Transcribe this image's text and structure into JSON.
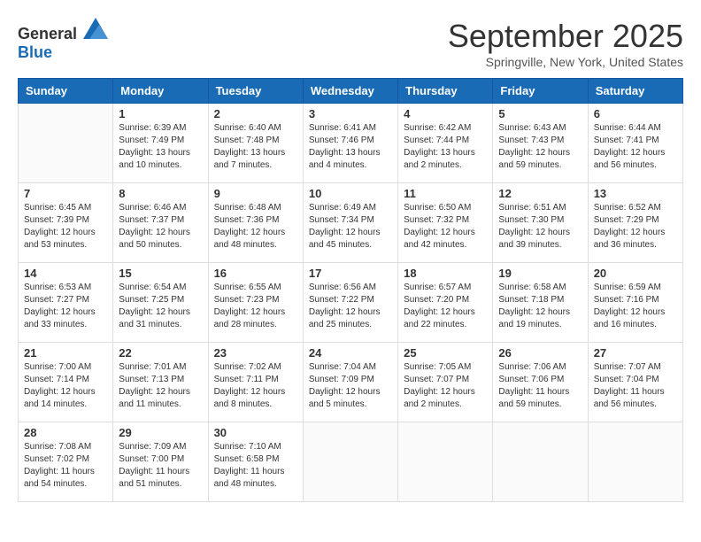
{
  "header": {
    "logo_general": "General",
    "logo_blue": "Blue",
    "month_title": "September 2025",
    "location": "Springville, New York, United States"
  },
  "weekdays": [
    "Sunday",
    "Monday",
    "Tuesday",
    "Wednesday",
    "Thursday",
    "Friday",
    "Saturday"
  ],
  "weeks": [
    [
      {
        "day": "",
        "info": ""
      },
      {
        "day": "1",
        "info": "Sunrise: 6:39 AM\nSunset: 7:49 PM\nDaylight: 13 hours\nand 10 minutes."
      },
      {
        "day": "2",
        "info": "Sunrise: 6:40 AM\nSunset: 7:48 PM\nDaylight: 13 hours\nand 7 minutes."
      },
      {
        "day": "3",
        "info": "Sunrise: 6:41 AM\nSunset: 7:46 PM\nDaylight: 13 hours\nand 4 minutes."
      },
      {
        "day": "4",
        "info": "Sunrise: 6:42 AM\nSunset: 7:44 PM\nDaylight: 13 hours\nand 2 minutes."
      },
      {
        "day": "5",
        "info": "Sunrise: 6:43 AM\nSunset: 7:43 PM\nDaylight: 12 hours\nand 59 minutes."
      },
      {
        "day": "6",
        "info": "Sunrise: 6:44 AM\nSunset: 7:41 PM\nDaylight: 12 hours\nand 56 minutes."
      }
    ],
    [
      {
        "day": "7",
        "info": "Sunrise: 6:45 AM\nSunset: 7:39 PM\nDaylight: 12 hours\nand 53 minutes."
      },
      {
        "day": "8",
        "info": "Sunrise: 6:46 AM\nSunset: 7:37 PM\nDaylight: 12 hours\nand 50 minutes."
      },
      {
        "day": "9",
        "info": "Sunrise: 6:48 AM\nSunset: 7:36 PM\nDaylight: 12 hours\nand 48 minutes."
      },
      {
        "day": "10",
        "info": "Sunrise: 6:49 AM\nSunset: 7:34 PM\nDaylight: 12 hours\nand 45 minutes."
      },
      {
        "day": "11",
        "info": "Sunrise: 6:50 AM\nSunset: 7:32 PM\nDaylight: 12 hours\nand 42 minutes."
      },
      {
        "day": "12",
        "info": "Sunrise: 6:51 AM\nSunset: 7:30 PM\nDaylight: 12 hours\nand 39 minutes."
      },
      {
        "day": "13",
        "info": "Sunrise: 6:52 AM\nSunset: 7:29 PM\nDaylight: 12 hours\nand 36 minutes."
      }
    ],
    [
      {
        "day": "14",
        "info": "Sunrise: 6:53 AM\nSunset: 7:27 PM\nDaylight: 12 hours\nand 33 minutes."
      },
      {
        "day": "15",
        "info": "Sunrise: 6:54 AM\nSunset: 7:25 PM\nDaylight: 12 hours\nand 31 minutes."
      },
      {
        "day": "16",
        "info": "Sunrise: 6:55 AM\nSunset: 7:23 PM\nDaylight: 12 hours\nand 28 minutes."
      },
      {
        "day": "17",
        "info": "Sunrise: 6:56 AM\nSunset: 7:22 PM\nDaylight: 12 hours\nand 25 minutes."
      },
      {
        "day": "18",
        "info": "Sunrise: 6:57 AM\nSunset: 7:20 PM\nDaylight: 12 hours\nand 22 minutes."
      },
      {
        "day": "19",
        "info": "Sunrise: 6:58 AM\nSunset: 7:18 PM\nDaylight: 12 hours\nand 19 minutes."
      },
      {
        "day": "20",
        "info": "Sunrise: 6:59 AM\nSunset: 7:16 PM\nDaylight: 12 hours\nand 16 minutes."
      }
    ],
    [
      {
        "day": "21",
        "info": "Sunrise: 7:00 AM\nSunset: 7:14 PM\nDaylight: 12 hours\nand 14 minutes."
      },
      {
        "day": "22",
        "info": "Sunrise: 7:01 AM\nSunset: 7:13 PM\nDaylight: 12 hours\nand 11 minutes."
      },
      {
        "day": "23",
        "info": "Sunrise: 7:02 AM\nSunset: 7:11 PM\nDaylight: 12 hours\nand 8 minutes."
      },
      {
        "day": "24",
        "info": "Sunrise: 7:04 AM\nSunset: 7:09 PM\nDaylight: 12 hours\nand 5 minutes."
      },
      {
        "day": "25",
        "info": "Sunrise: 7:05 AM\nSunset: 7:07 PM\nDaylight: 12 hours\nand 2 minutes."
      },
      {
        "day": "26",
        "info": "Sunrise: 7:06 AM\nSunset: 7:06 PM\nDaylight: 11 hours\nand 59 minutes."
      },
      {
        "day": "27",
        "info": "Sunrise: 7:07 AM\nSunset: 7:04 PM\nDaylight: 11 hours\nand 56 minutes."
      }
    ],
    [
      {
        "day": "28",
        "info": "Sunrise: 7:08 AM\nSunset: 7:02 PM\nDaylight: 11 hours\nand 54 minutes."
      },
      {
        "day": "29",
        "info": "Sunrise: 7:09 AM\nSunset: 7:00 PM\nDaylight: 11 hours\nand 51 minutes."
      },
      {
        "day": "30",
        "info": "Sunrise: 7:10 AM\nSunset: 6:58 PM\nDaylight: 11 hours\nand 48 minutes."
      },
      {
        "day": "",
        "info": ""
      },
      {
        "day": "",
        "info": ""
      },
      {
        "day": "",
        "info": ""
      },
      {
        "day": "",
        "info": ""
      }
    ]
  ]
}
